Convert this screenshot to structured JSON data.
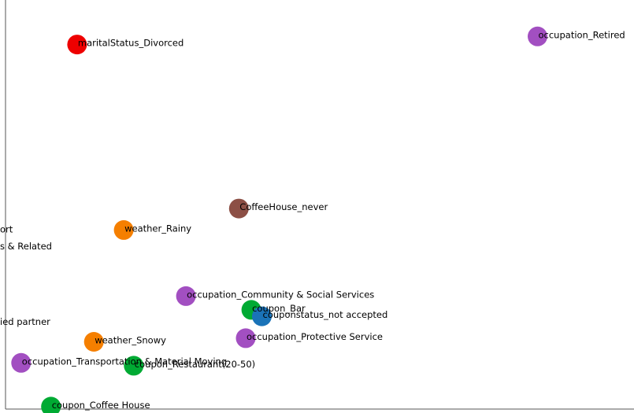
{
  "chart_data": {
    "type": "scatter",
    "title": "",
    "xlabel": "",
    "ylabel": "",
    "grid": false,
    "xlim": [
      -1,
      100
    ],
    "ylim": [
      -1,
      100
    ],
    "points": [
      {
        "label": "maritalStatus_Divorced",
        "x": 10.5,
        "y": 89.0,
        "color": "#ee0000"
      },
      {
        "label": "occupation_Retired",
        "x": 84.5,
        "y": 91.0,
        "color": "#a24fc1"
      },
      {
        "label": "CoffeeHouse_never",
        "x": 36.5,
        "y": 48.5,
        "color": "#8c4f45"
      },
      {
        "label": "weather_Rainy",
        "x": 18.0,
        "y": 43.2,
        "color": "#f57f00"
      },
      {
        "label": "occupation_Community & Social Services",
        "x": 28.0,
        "y": 26.9,
        "color": "#a24fc1"
      },
      {
        "label": "coupon_Bar",
        "x": 38.5,
        "y": 23.5,
        "color": "#00aa33"
      },
      {
        "label": "couponstatus_not accepted",
        "x": 40.2,
        "y": 21.9,
        "color": "#1a73b8"
      },
      {
        "label": "occupation_Protective Service",
        "x": 37.6,
        "y": 16.5,
        "color": "#a24fc1"
      },
      {
        "label": "weather_Snowy",
        "x": 13.2,
        "y": 15.6,
        "color": "#f57f00"
      },
      {
        "label": "coupon_Restaurant(20-50)",
        "x": 19.6,
        "y": 9.7,
        "color": "#00aa33"
      },
      {
        "label": "occupation_Transportation & Material Moving",
        "x": 1.5,
        "y": 10.4,
        "color": "#a24fc1"
      },
      {
        "label": "coupon_Coffee House",
        "x": 6.3,
        "y": -0.4,
        "color": "#00aa33"
      }
    ],
    "clipped_labels": [
      {
        "label": "ort",
        "x": 0.0,
        "y": 43.0
      },
      {
        "label": "s & Related",
        "x": 0.0,
        "y": 38.8
      },
      {
        "label": "ied partner",
        "x": 0.0,
        "y": 20.2
      }
    ]
  }
}
